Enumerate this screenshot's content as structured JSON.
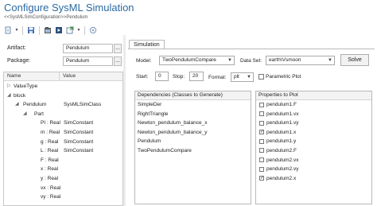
{
  "window": {
    "title": "Configure SysML Simulation",
    "breadcrumb": "<<SysMLSimConfiguration>>Pendulum"
  },
  "toolbar": {
    "icons": [
      "new-doc-icon",
      "save-icon",
      "open-icon",
      "run-icon",
      "export-icon",
      "settings-icon"
    ]
  },
  "config": {
    "artifact_label": "Artifact:",
    "artifact_value": "Pendulum",
    "package_label": "Package:",
    "package_value": "Pendulum",
    "browse_label": "..."
  },
  "tree": {
    "headers": {
      "name": "Name",
      "value": "Value"
    },
    "rows": [
      {
        "toggle": "▷",
        "name": "ValueType",
        "value": ""
      },
      {
        "toggle": "◢",
        "name": "block",
        "value": ""
      },
      {
        "toggle": "◢",
        "name": "Pendulum",
        "value": "SysMLSimClass"
      },
      {
        "toggle": "◢",
        "name": "Part",
        "value": ""
      },
      {
        "toggle": "",
        "name": "PI : Real",
        "value": "SimConstant"
      },
      {
        "toggle": "",
        "name": "m : Real",
        "value": "SimConstant"
      },
      {
        "toggle": "",
        "name": "g : Real",
        "value": "SimConstant"
      },
      {
        "toggle": "",
        "name": "L : Real",
        "value": "SimConstant"
      },
      {
        "toggle": "",
        "name": "F : Real",
        "value": ""
      },
      {
        "toggle": "",
        "name": "x : Real",
        "value": ""
      },
      {
        "toggle": "",
        "name": "y : Real",
        "value": ""
      },
      {
        "toggle": "",
        "name": "vx : Real",
        "value": ""
      },
      {
        "toggle": "",
        "name": "vy : Real",
        "value": ""
      }
    ]
  },
  "simulation": {
    "tab_label": "Simulation",
    "model_label": "Model:",
    "model_value": "TwoPendulumCompare",
    "dataset_label": "Data Set:",
    "dataset_value": "earth\\Vsmoon",
    "solve_label": "Solve",
    "start_label": "Start:",
    "start_value": "0",
    "stop_label": "Stop:",
    "stop_value": "20",
    "format_label": "Format:",
    "format_value": "plt",
    "parametric_label": "Parametric Plot",
    "parametric_checked": false
  },
  "dependencies": {
    "header": "Dependencies (Classes to Generate)",
    "items": [
      "SimpleDer",
      "RightTriangle",
      "Newton_pendulum_balance_x",
      "Newton_pendulum_balance_y",
      "Pendulum",
      "TwoPendulumCompare"
    ]
  },
  "properties": {
    "header": "Properties to Plot",
    "items": [
      {
        "name": "pendulum1.F",
        "checked": false
      },
      {
        "name": "pendulum1.vx",
        "checked": false
      },
      {
        "name": "pendulum1.vy",
        "checked": false
      },
      {
        "name": "pendulum1.x",
        "checked": true
      },
      {
        "name": "pendulum1.y",
        "checked": false
      },
      {
        "name": "pendulum2.F",
        "checked": false
      },
      {
        "name": "pendulum2.vx",
        "checked": false
      },
      {
        "name": "pendulum2.vy",
        "checked": false
      },
      {
        "name": "pendulum2.x",
        "checked": true
      }
    ]
  },
  "colors": {
    "title": "#2b6aa3",
    "check": "#333333"
  }
}
